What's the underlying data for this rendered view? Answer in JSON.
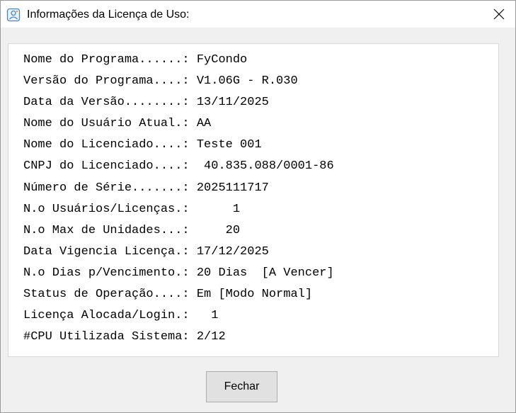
{
  "window": {
    "title": "Informações da Licença de Uso:",
    "icon": "app-icon",
    "close_icon": "close-icon"
  },
  "info": {
    "lines": [
      "Nome do Programa......: FyCondo",
      "Versão do Programa....: V1.06G - R.030",
      "Data da Versão........: 13/11/2025",
      "Nome do Usuário Atual.: AA",
      "Nome do Licenciado....: Teste 001",
      "CNPJ do Licenciado....:  40.835.088/0001-86",
      "Número de Série.......: 2025111717",
      "N.o Usuários/Licenças.:      1",
      "N.o Max de Unidades...:     20",
      "Data Vigencia Licença.: 17/12/2025",
      "N.o Dias p/Vencimento.: 20 Dias  [A Vencer]",
      "Status de Operação....: Em [Modo Normal]",
      "Licença Alocada/Login.:   1",
      "#CPU Utilizada Sistema: 2/12"
    ]
  },
  "footer": {
    "close_label": "Fechar"
  }
}
